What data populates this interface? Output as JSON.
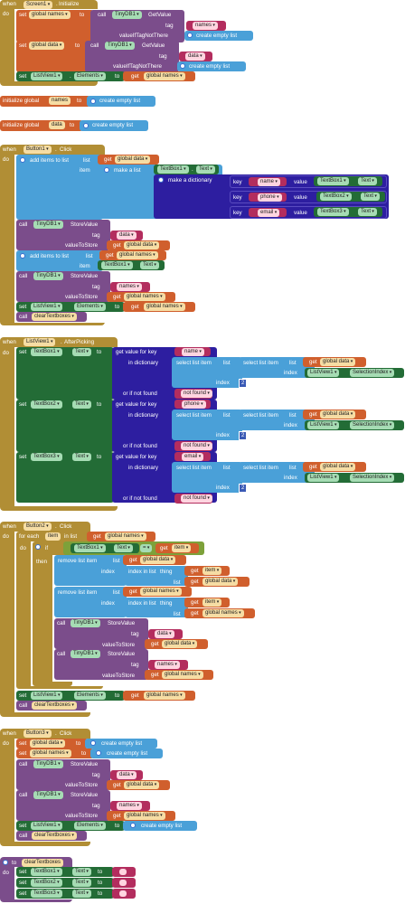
{
  "kw": {
    "when": "when",
    "do": "do",
    "set": "set",
    "to": "to",
    "call": "call",
    "get": "get",
    "initialize_global": "initialize global",
    "tag": "tag",
    "value_if_tag_not_there": "valueIfTagNotThere",
    "value_to_store": "valueToStore",
    "create_empty_list": "create empty list",
    "add_items_to_list": "add items to list",
    "list": "list",
    "item": "item",
    "make_a_list": "make a list",
    "make_a_dictionary": "make a dictionary",
    "key": "key",
    "value": "value",
    "get_value_for_key": "get value for key",
    "in_dictionary": "in dictionary",
    "or_if_not_found": "or if not found",
    "select_list_item": "select list item",
    "index": "index",
    "for_each": "for each",
    "in_list": "in list",
    "if": "if",
    "then": "then",
    "remove_list_item": "remove list item",
    "index_in_list": "index in list",
    "thing": "thing",
    "eq": "=",
    "period": "."
  },
  "components": {
    "screen1": "Screen1",
    "tinydb1": "TinyDB1",
    "listview1": "ListView1",
    "button1": "Button1",
    "button2": "Button2",
    "button3": "Button3",
    "textbox1": "TextBox1",
    "textbox2": "TextBox2",
    "textbox3": "TextBox3"
  },
  "events": {
    "initialize": "Initialize",
    "click": "Click",
    "after_picking": "AfterPicking"
  },
  "methods": {
    "get_value": "GetValue",
    "store_value": "StoreValue"
  },
  "props": {
    "elements": "Elements",
    "text": "Text",
    "selection_index": "SelectionIndex"
  },
  "vars": {
    "names": "names",
    "data": "data",
    "global_names": "global names",
    "global_data": "global data",
    "item": "item"
  },
  "strings": {
    "names": "names",
    "data": "data",
    "name": "name",
    "phone": "phone",
    "email": "email",
    "not_found": "not found",
    "empty": ""
  },
  "numbers": {
    "two": "2"
  },
  "procedures": {
    "clear_textboxes": "clearTextboxes"
  }
}
